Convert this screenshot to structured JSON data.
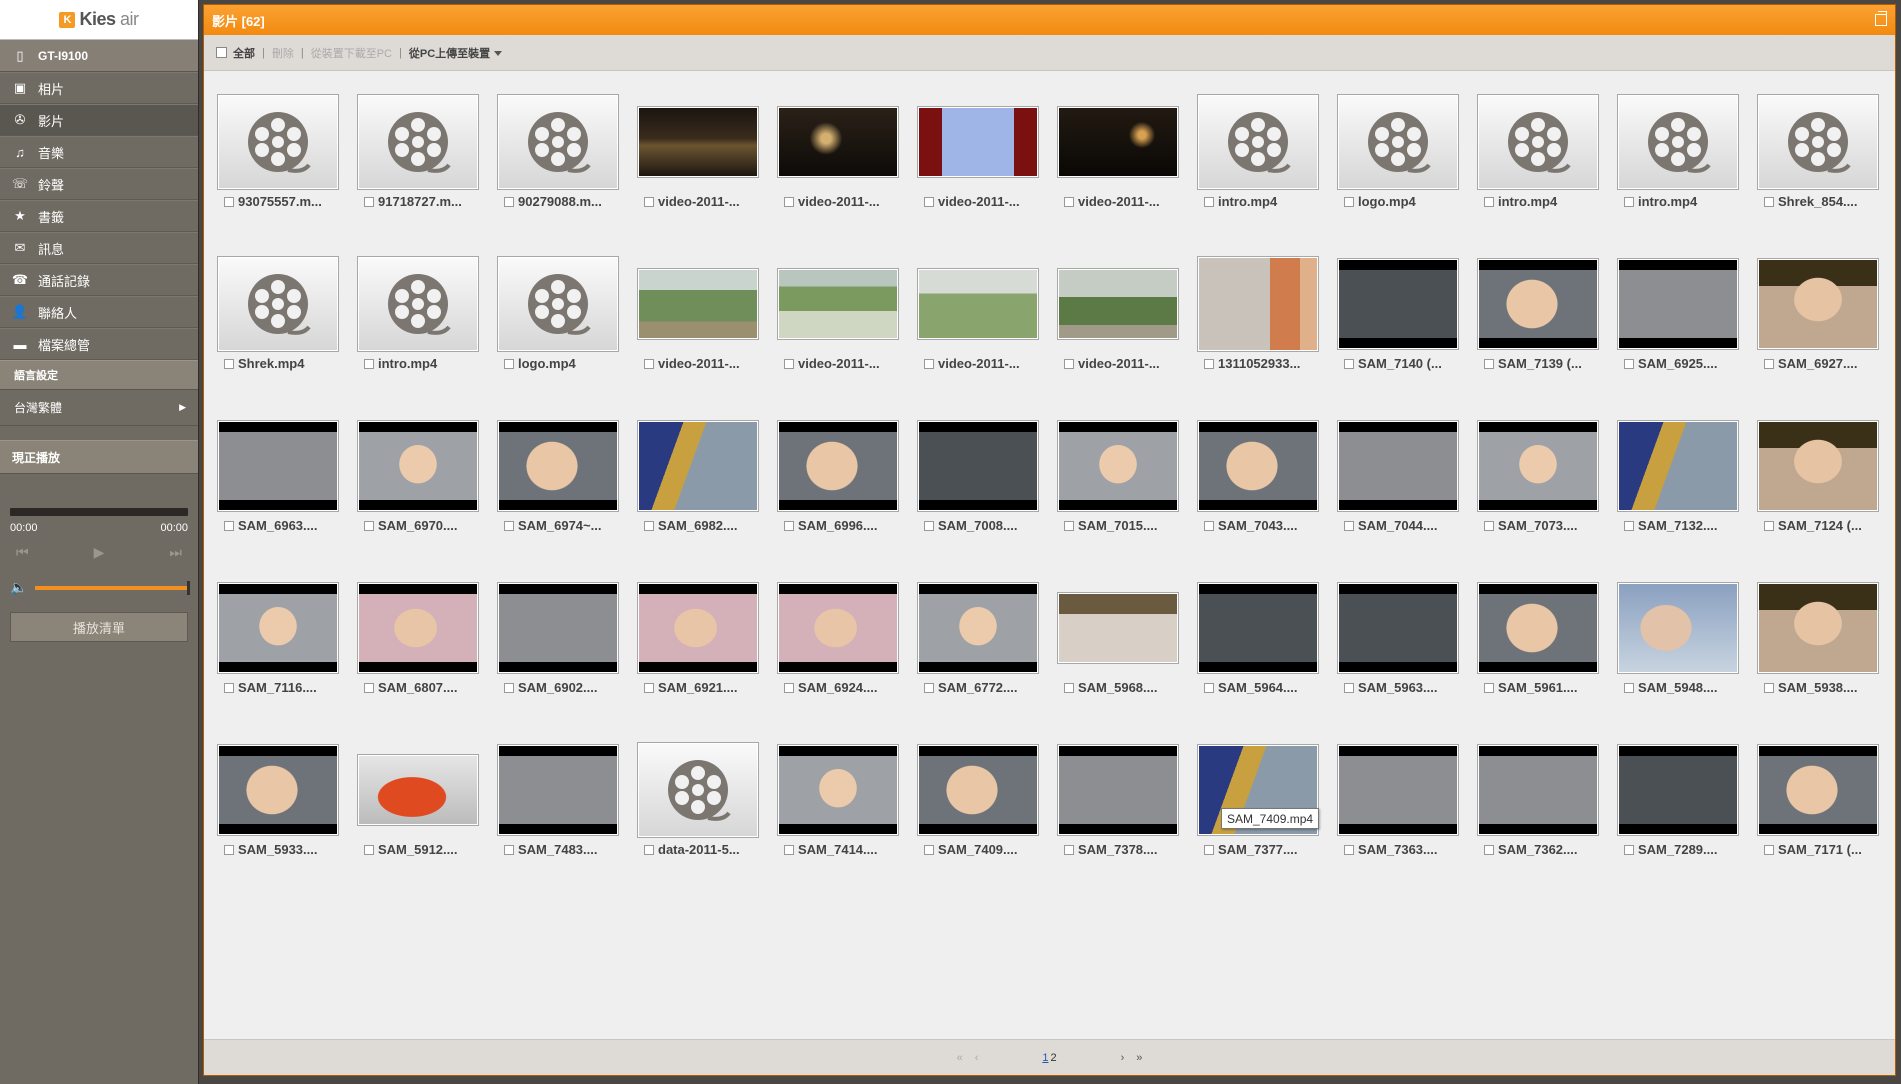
{
  "app": {
    "logo_badge": "K",
    "logo_name": "Kies",
    "logo_suffix": "air"
  },
  "sidebar": {
    "device": "GT-I9100",
    "items": [
      {
        "label": "相片",
        "icon": "photo-icon",
        "glyph": "▣"
      },
      {
        "label": "影片",
        "icon": "film-reel-icon",
        "glyph": "✇"
      },
      {
        "label": "音樂",
        "icon": "music-icon",
        "glyph": "♫"
      },
      {
        "label": "鈴聲",
        "icon": "ringtone-icon",
        "glyph": "☏"
      },
      {
        "label": "書籤",
        "icon": "bookmark-icon",
        "glyph": "★"
      },
      {
        "label": "訊息",
        "icon": "message-icon",
        "glyph": "✉"
      },
      {
        "label": "通話記錄",
        "icon": "call-log-icon",
        "glyph": "☎"
      },
      {
        "label": "聯絡人",
        "icon": "contact-icon",
        "glyph": "👤"
      },
      {
        "label": "檔案總管",
        "icon": "folder-icon",
        "glyph": "▬"
      }
    ],
    "lang_section": "語言設定",
    "language": "台灣繁體",
    "now_playing": "現正播放",
    "time_start": "00:00",
    "time_end": "00:00",
    "playlist": "播放清單"
  },
  "main": {
    "title": "影片 [62]",
    "toolbar": {
      "select_all": "全部",
      "delete": "刪除",
      "download": "從裝置下載至PC",
      "upload": "從PC上傳至裝置"
    },
    "tooltip": "SAM_7409.mp4",
    "pager": {
      "page1": "1",
      "page2": "2"
    },
    "videos": [
      {
        "name": "93075557.m...",
        "t": "reel"
      },
      {
        "name": "91718727.m...",
        "t": "reel"
      },
      {
        "name": "90279088.m...",
        "t": "reel"
      },
      {
        "name": "video-2011-...",
        "t": "night1"
      },
      {
        "name": "video-2011-...",
        "t": "night2"
      },
      {
        "name": "video-2011-...",
        "t": "car"
      },
      {
        "name": "video-2011-...",
        "t": "night3"
      },
      {
        "name": "intro.mp4",
        "t": "reel"
      },
      {
        "name": "logo.mp4",
        "t": "reel"
      },
      {
        "name": "intro.mp4",
        "t": "reel"
      },
      {
        "name": "intro.mp4",
        "t": "reel"
      },
      {
        "name": "Shrek_854....",
        "t": "reel"
      },
      {
        "name": "Shrek.mp4",
        "t": "reel"
      },
      {
        "name": "intro.mp4",
        "t": "reel"
      },
      {
        "name": "logo.mp4",
        "t": "reel"
      },
      {
        "name": "video-2011-...",
        "t": "forest1"
      },
      {
        "name": "video-2011-...",
        "t": "forest2"
      },
      {
        "name": "video-2011-...",
        "t": "forest3"
      },
      {
        "name": "video-2011-...",
        "t": "forest4"
      },
      {
        "name": "1311052933...",
        "t": "room"
      },
      {
        "name": "SAM_7140 (...",
        "t": "baby1"
      },
      {
        "name": "SAM_7139 (...",
        "t": "baby2"
      },
      {
        "name": "SAM_6925....",
        "t": "baby3"
      },
      {
        "name": "SAM_6927....",
        "t": "baby4"
      },
      {
        "name": "SAM_6963....",
        "t": "baby3"
      },
      {
        "name": "SAM_6970....",
        "t": "baby5"
      },
      {
        "name": "SAM_6974~...",
        "t": "baby2"
      },
      {
        "name": "SAM_6982....",
        "t": "baby6"
      },
      {
        "name": "SAM_6996....",
        "t": "baby2"
      },
      {
        "name": "SAM_7008....",
        "t": "baby1"
      },
      {
        "name": "SAM_7015....",
        "t": "baby5"
      },
      {
        "name": "SAM_7043....",
        "t": "baby2"
      },
      {
        "name": "SAM_7044....",
        "t": "baby3"
      },
      {
        "name": "SAM_7073....",
        "t": "baby5"
      },
      {
        "name": "SAM_7132....",
        "t": "baby6"
      },
      {
        "name": "SAM_7124 (...",
        "t": "baby4"
      },
      {
        "name": "SAM_7116....",
        "t": "baby5"
      },
      {
        "name": "SAM_6807....",
        "t": "baby7"
      },
      {
        "name": "SAM_6902....",
        "t": "baby3"
      },
      {
        "name": "SAM_6921....",
        "t": "baby7"
      },
      {
        "name": "SAM_6924....",
        "t": "baby7"
      },
      {
        "name": "SAM_6772....",
        "t": "baby5"
      },
      {
        "name": "SAM_5968....",
        "t": "baby8"
      },
      {
        "name": "SAM_5964....",
        "t": "baby1"
      },
      {
        "name": "SAM_5963....",
        "t": "baby1"
      },
      {
        "name": "SAM_5961....",
        "t": "baby2"
      },
      {
        "name": "SAM_5948....",
        "t": "baby9"
      },
      {
        "name": "SAM_5938....",
        "t": "baby4"
      },
      {
        "name": "SAM_5933....",
        "t": "baby2"
      },
      {
        "name": "SAM_5912....",
        "t": "bath"
      },
      {
        "name": "SAM_7483....",
        "t": "baby3"
      },
      {
        "name": "data-2011-5...",
        "t": "reel"
      },
      {
        "name": "SAM_7414....",
        "t": "baby5"
      },
      {
        "name": "SAM_7409....",
        "t": "baby2"
      },
      {
        "name": "SAM_7378....",
        "t": "baby3"
      },
      {
        "name": "SAM_7377....",
        "t": "baby6"
      },
      {
        "name": "SAM_7363....",
        "t": "baby3"
      },
      {
        "name": "SAM_7362....",
        "t": "baby3"
      },
      {
        "name": "SAM_7289....",
        "t": "baby1"
      },
      {
        "name": "SAM_7171 (...",
        "t": "baby2"
      }
    ]
  },
  "colors": {
    "accent": "#f38a10",
    "sidebar": "#6f6a62",
    "link": "#2a55b0"
  }
}
